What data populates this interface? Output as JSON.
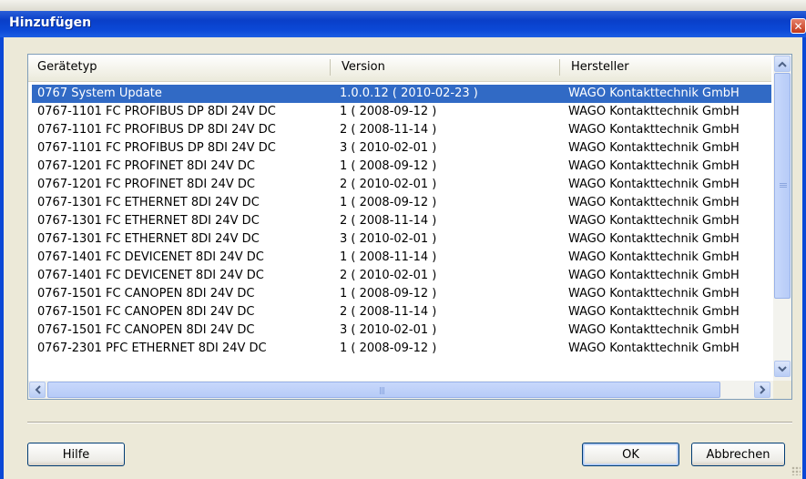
{
  "window": {
    "title": "Hinzufügen",
    "close_glyph": "✕"
  },
  "table": {
    "columns": [
      "Gerätetyp",
      "Version",
      "Hersteller"
    ],
    "selected_index": 0,
    "rows": [
      [
        "0767 System Update",
        "1.0.0.12 ( 2010-02-23 )",
        "WAGO Kontakttechnik GmbH"
      ],
      [
        "0767-1101 FC PROFIBUS DP 8DI 24V DC",
        "1 ( 2008-09-12 )",
        "WAGO Kontakttechnik GmbH"
      ],
      [
        "0767-1101 FC PROFIBUS DP 8DI 24V DC",
        "2 ( 2008-11-14 )",
        "WAGO Kontakttechnik GmbH"
      ],
      [
        "0767-1101 FC PROFIBUS DP 8DI 24V DC",
        "3 ( 2010-02-01 )",
        "WAGO Kontakttechnik GmbH"
      ],
      [
        "0767-1201 FC PROFINET 8DI 24V DC",
        "1 ( 2008-09-12 )",
        "WAGO Kontakttechnik GmbH"
      ],
      [
        "0767-1201 FC PROFINET 8DI 24V DC",
        "2 ( 2010-02-01 )",
        "WAGO Kontakttechnik GmbH"
      ],
      [
        "0767-1301 FC ETHERNET 8DI 24V DC",
        "1 ( 2008-09-12 )",
        "WAGO Kontakttechnik GmbH"
      ],
      [
        "0767-1301 FC ETHERNET 8DI 24V DC",
        "2 ( 2008-11-14 )",
        "WAGO Kontakttechnik GmbH"
      ],
      [
        "0767-1301 FC ETHERNET 8DI 24V DC",
        "3 ( 2010-02-01 )",
        "WAGO Kontakttechnik GmbH"
      ],
      [
        "0767-1401 FC DEVICENET 8DI 24V DC",
        "1 ( 2008-11-14 )",
        "WAGO Kontakttechnik GmbH"
      ],
      [
        "0767-1401 FC DEVICENET 8DI 24V DC",
        "2 ( 2010-02-01 )",
        "WAGO Kontakttechnik GmbH"
      ],
      [
        "0767-1501 FC CANOPEN 8DI 24V DC",
        "1 ( 2008-09-12 )",
        "WAGO Kontakttechnik GmbH"
      ],
      [
        "0767-1501 FC CANOPEN 8DI 24V DC",
        "2 ( 2008-11-14 )",
        "WAGO Kontakttechnik GmbH"
      ],
      [
        "0767-1501 FC CANOPEN 8DI 24V DC",
        "3 ( 2010-02-01 )",
        "WAGO Kontakttechnik GmbH"
      ],
      [
        "0767-2301 PFC ETHERNET 8DI 24V DC",
        "1 ( 2008-09-12 )",
        "WAGO Kontakttechnik GmbH"
      ]
    ]
  },
  "buttons": {
    "help": "Hilfe",
    "ok": "OK",
    "cancel": "Abbrechen"
  },
  "icons": {
    "scroll_up": "chevron-up-icon",
    "scroll_down": "chevron-down-icon",
    "scroll_left": "chevron-left-icon",
    "scroll_right": "chevron-right-icon"
  },
  "colors": {
    "titlebar": "#0b48d6",
    "selection": "#316ac5",
    "close": "#c2391b"
  }
}
